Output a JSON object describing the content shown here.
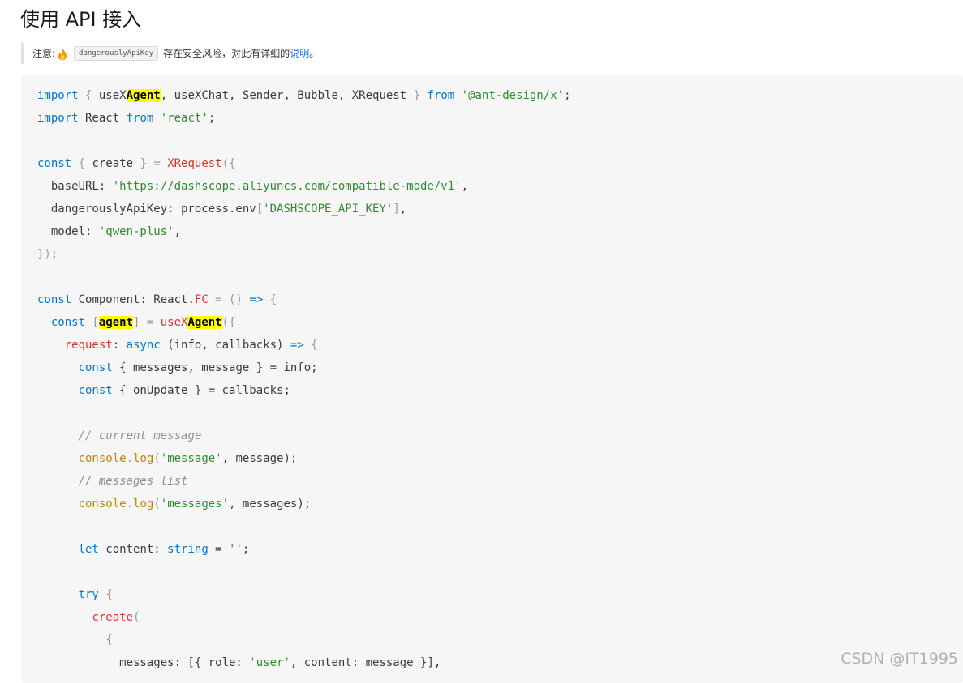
{
  "page": {
    "title": "使用 API 接入"
  },
  "note": {
    "prefix": "注意:",
    "icon": "fire-icon",
    "code": "dangerouslyApiKey",
    "text": "存在安全风险，对此有详细的",
    "link_label": "说明",
    "suffix": "。"
  },
  "code": {
    "l01": {
      "a": "import",
      "b": " { ",
      "c": "useX",
      "d": "Agent",
      "e": ", useXChat, Sender, Bubble, XRequest ",
      "f": "}",
      "g": " from ",
      "h": "'@ant-design/x'",
      "i": ";"
    },
    "l02": {
      "a": "import",
      "b": " React ",
      "c": "from",
      "d": " ",
      "e": "'react'",
      "f": ";"
    },
    "l04": {
      "a": "const",
      "b": " { ",
      "c": "create",
      "d": " } = ",
      "e": "XRequest",
      "f": "({"
    },
    "l05": {
      "a": "  baseURL: ",
      "b": "'https://dashscope.aliyuncs.com/compatible-mode/v1'",
      "c": ","
    },
    "l06": {
      "a": "  dangerouslyApiKey: process.env",
      "b": "[",
      "c": "'DASHSCOPE_API_KEY'",
      "d": "]",
      "e": ","
    },
    "l07": {
      "a": "  model: ",
      "b": "'qwen-plus'",
      "c": ","
    },
    "l08": {
      "a": "});"
    },
    "l10": {
      "a": "const",
      "b": " Component: React.",
      "c": "FC",
      "d": " = () ",
      "e": "=>",
      "f": " {"
    },
    "l11": {
      "a": "  ",
      "b": "const",
      "c": " [",
      "d": "agent",
      "e": "] = ",
      "f": "useX",
      "g": "Agent",
      "h": "({"
    },
    "l12": {
      "a": "    ",
      "b": "request",
      "c": ": ",
      "d": "async",
      "e": " (info, callbacks) ",
      "f": "=>",
      "g": " {"
    },
    "l13": {
      "a": "      ",
      "b": "const",
      "c": " { messages, message } = info;"
    },
    "l14": {
      "a": "      ",
      "b": "const",
      "c": " { onUpdate } = callbacks;"
    },
    "l16": {
      "a": "      ",
      "b": "// current message"
    },
    "l17": {
      "a": "      ",
      "b": "console",
      "c": ".",
      "d": "log",
      "e": "(",
      "f": "'message'",
      "g": ", message);"
    },
    "l18": {
      "a": "      ",
      "b": "// messages list"
    },
    "l19": {
      "a": "      ",
      "b": "console",
      "c": ".",
      "d": "log",
      "e": "(",
      "f": "'messages'",
      "g": ", messages);"
    },
    "l21": {
      "a": "      ",
      "b": "let",
      "c": " content: ",
      "d": "string",
      "e": " = ",
      "f": "''",
      "g": ";"
    },
    "l23": {
      "a": "      ",
      "b": "try",
      "c": " {"
    },
    "l24": {
      "a": "        ",
      "b": "create",
      "c": "("
    },
    "l25": {
      "a": "          {"
    },
    "l26": {
      "a": "            messages: [{ role: ",
      "b": "'user'",
      "c": ", content: message }],"
    }
  },
  "watermark": "CSDN @IT1995"
}
